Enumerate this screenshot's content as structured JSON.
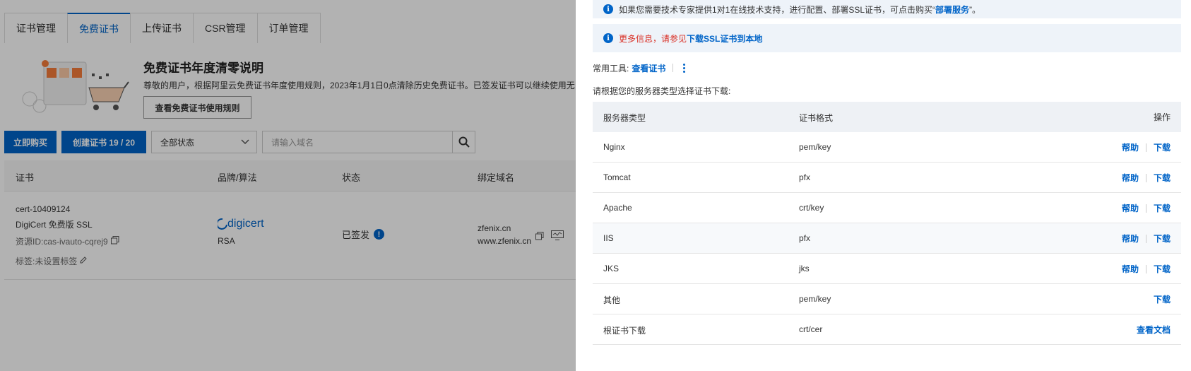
{
  "tabs": [
    "证书管理",
    "免费证书",
    "上传证书",
    "CSR管理",
    "订单管理"
  ],
  "notice": {
    "title": "免费证书年度清零说明",
    "desc": "尊敬的用户，根据阿里云免费证书年度使用规则，2023年1月1日0点清除历史免费证书。已签发证书可以继续使用无",
    "rule_button": "查看免费证书使用规则"
  },
  "toolbar": {
    "buy": "立即购买",
    "create": "创建证书 19 / 20",
    "status_select": "全部状态",
    "search_placeholder": "请输入域名"
  },
  "cert_table": {
    "headers": [
      "证书",
      "品牌/算法",
      "状态",
      "绑定域名"
    ],
    "row": {
      "cert_id": "cert-10409124",
      "cert_name": "DigiCert 免费版 SSL",
      "resource_id": "资源ID:cas-ivauto-cqrej9",
      "tag": "标签:未设置标签",
      "brand": "digicert",
      "algo": "RSA",
      "status": "已签发",
      "domain1": "zfenix.cn",
      "domain2": "www.zfenix.cn"
    }
  },
  "drawer": {
    "info1_text": "如果您需要技术专家提供1对1在线技术支持，进行配置、部署SSL证书，可点击购买“",
    "info1_link": "部署服务",
    "info1_tail": "”。",
    "info2_prefix": "更多信息，请参见",
    "info2_link": "下载SSL证书到本地",
    "tools_label": "常用工具:",
    "tools_link": "查看证书",
    "hint": "请根据您的服务器类型选择证书下载:",
    "table_headers": {
      "server": "服务器类型",
      "format": "证书格式",
      "action": "操作"
    },
    "help_label": "帮助",
    "download_label": "下载",
    "doc_label": "查看文档",
    "rows": [
      {
        "server": "Nginx",
        "format": "pem/key"
      },
      {
        "server": "Tomcat",
        "format": "pfx"
      },
      {
        "server": "Apache",
        "format": "crt/key"
      },
      {
        "server": "IIS",
        "format": "pfx"
      },
      {
        "server": "JKS",
        "format": "jks"
      },
      {
        "server": "其他",
        "format": "pem/key"
      },
      {
        "server": "根证书下载",
        "format": "crt/cer"
      }
    ]
  },
  "colors": {
    "primary": "#0064c8",
    "warning_red": "#d93026",
    "info_bg": "#eef3f9"
  }
}
